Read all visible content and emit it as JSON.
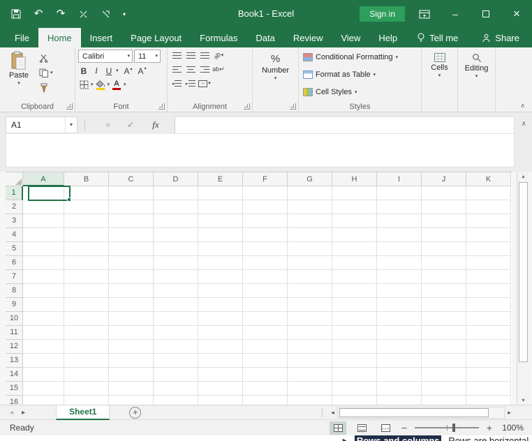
{
  "colors": {
    "brand_green": "#217346",
    "sign_in_button_green": "#2e9e5b",
    "active_cell_green": "#1e7145",
    "selection_highlight": "#e0ebe4",
    "background_text_highlight": "#1f2d46"
  },
  "window": {
    "title": "Book1 - Excel",
    "sign_in_label": "Sign in"
  },
  "ribbon_tabs": [
    "File",
    "Home",
    "Insert",
    "Page Layout",
    "Formulas",
    "Data",
    "Review",
    "View",
    "Help"
  ],
  "tab_extras": {
    "tell_me_label": "Tell me",
    "share_label": "Share"
  },
  "ribbon": {
    "clipboard": {
      "group_label": "Clipboard",
      "paste_label": "Paste"
    },
    "font": {
      "group_label": "Font",
      "font_name": "Calibri",
      "font_size": "11",
      "bold_glyph": "B",
      "italic_glyph": "I",
      "underline_glyph": "U",
      "grow_font_glyph": "A",
      "shrink_font_glyph": "A",
      "font_color_glyph": "A"
    },
    "alignment": {
      "group_label": "Alignment"
    },
    "number": {
      "button_label": "Number",
      "percent_glyph": "%"
    },
    "styles": {
      "group_label": "Styles",
      "conditional_formatting_label": "Conditional Formatting",
      "format_as_table_label": "Format as Table",
      "cell_styles_label": "Cell Styles"
    },
    "cells": {
      "button_label": "Cells"
    },
    "editing": {
      "button_label": "Editing"
    }
  },
  "formula_bar": {
    "name_box_value": "A1",
    "cancel_glyph": "×",
    "enter_glyph": "✓",
    "fx_label": "fx"
  },
  "grid": {
    "columns": [
      "A",
      "B",
      "C",
      "D",
      "E",
      "F",
      "G",
      "H",
      "I",
      "J",
      "K"
    ],
    "rows": [
      "1",
      "2",
      "3",
      "4",
      "5",
      "6",
      "7",
      "8",
      "9",
      "10",
      "11",
      "12",
      "13",
      "14",
      "15",
      "16"
    ],
    "selected_cell": "A1"
  },
  "sheet_bar": {
    "active_sheet_label": "Sheet1"
  },
  "status_bar": {
    "status_label": "Ready",
    "zoom_out_glyph": "−",
    "zoom_in_glyph": "+",
    "zoom_value": "100%"
  },
  "background_page": {
    "bullet_item_text": "Rows and columns",
    "paragraph_text": "Rows are horizontal arrang"
  },
  "icons": {
    "dropdown": "▾",
    "undo": "↶",
    "redo": "↷",
    "minimize": "–",
    "close": "×",
    "caret_up": "▴",
    "caret_down": "▾",
    "scroll_left": "◂",
    "scroll_right": "▸",
    "collapse": "∧",
    "bullet": "►",
    "add_sheet": "+",
    "orientation": "ab",
    "wrap_text": "ab↵",
    "merge": "↔"
  }
}
